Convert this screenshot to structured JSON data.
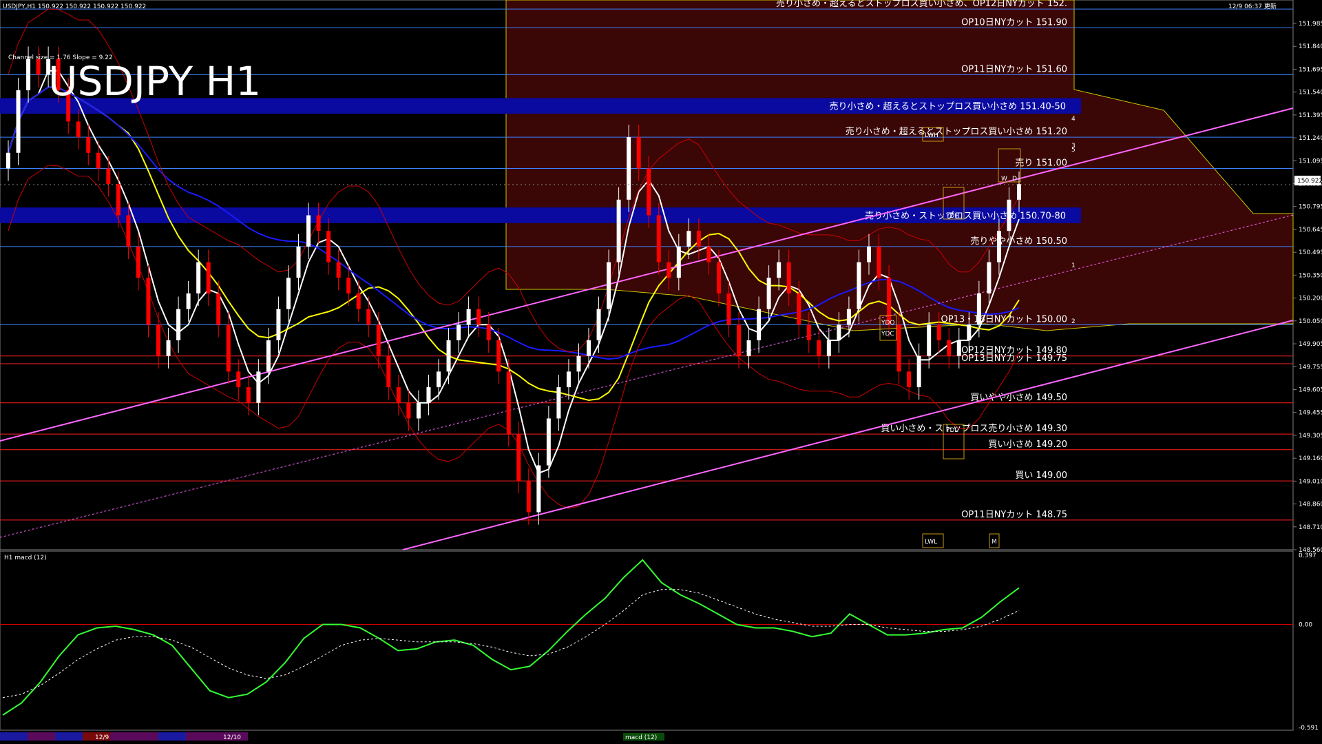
{
  "header": {
    "symbol_line": "USDJPY,H1  150.922 150.922 150.922 150.922",
    "updated": "12/9 06:37 更新",
    "watermark": "USDJPY H1",
    "channel_info": "Channel size = 1.76 Slope = 9.22"
  },
  "colors": {
    "background": "#000000",
    "bull_candle": "#ffffff",
    "bear_candle": "#ff0000",
    "ma_fast": "#ffffff",
    "ma_mid": "#ffff00",
    "ma_slow": "#1a1aff",
    "bollinger": "#cc0000",
    "rci": "#00cc00",
    "channel": "#ff66ff",
    "cloud": "#cc2222",
    "band_zone": "#0a0aa0"
  },
  "price_axis": {
    "ticks": [
      "151.985",
      "151.840",
      "151.695",
      "151.540",
      "151.395",
      "151.240",
      "151.095",
      "150.950",
      "150.795",
      "150.645",
      "150.495",
      "150.350",
      "150.200",
      "150.050",
      "149.905",
      "149.755",
      "149.605",
      "149.455",
      "149.305",
      "149.160",
      "149.010",
      "148.860",
      "148.710",
      "148.560"
    ],
    "current_price": "150.922"
  },
  "macd_axis": {
    "label": "H1 macd (12)",
    "ticks": [
      "0.397",
      "0.00",
      "-0.591"
    ]
  },
  "time_tabs": [
    "12/9",
    "12/10"
  ],
  "bottom_tag": "macd (12)",
  "zones": [
    {
      "name": "zone-151-40",
      "label": "売り小さめ・超えるとストップロス買い小さめ 151.40-50",
      "price": 151.4
    },
    {
      "name": "zone-150-70",
      "label": "売り小さめ・ストップロス買い小さめ 150.70-80",
      "price": 150.7
    }
  ],
  "levels": [
    {
      "name": "level-152",
      "label": "売り小さめ・超えるとストップロス買い小さめ、OP12日NYカット 152.",
      "price": 152.02,
      "color": "#3c82ff"
    },
    {
      "name": "level-151-90",
      "label": "OP10日NYカット 151.90",
      "price": 151.9,
      "color": "#3c82ff"
    },
    {
      "name": "level-151-60",
      "label": "OP11日NYカット 151.60",
      "price": 151.6,
      "color": "#3c82ff"
    },
    {
      "name": "level-151-20",
      "label": "売り小さめ・超えるとストップロス買い小さめ 151.20",
      "price": 151.2,
      "color": "#3c82ff"
    },
    {
      "name": "level-151-00",
      "label": "売り 151.00",
      "price": 151.0,
      "color": "#3c82ff"
    },
    {
      "name": "level-150-50",
      "label": "売りやや小さめ 150.50",
      "price": 150.5,
      "color": "#3c82ff"
    },
    {
      "name": "level-150-00",
      "label": "OP13・16日NYカット 150.00",
      "price": 150.0,
      "color": "#3c82ff"
    },
    {
      "name": "level-149-80",
      "label": "OP12日NYカット 149.80",
      "price": 149.8,
      "color": "#ff2020"
    },
    {
      "name": "level-149-75",
      "label": "OP13日NYカット 149.75",
      "price": 149.75,
      "color": "#ff2020"
    },
    {
      "name": "level-149-50",
      "label": "買いやや小さめ 149.50",
      "price": 149.5,
      "color": "#ff2020"
    },
    {
      "name": "level-149-30",
      "label": "買い小さめ・ストップロス売り小さめ 149.30",
      "price": 149.3,
      "color": "#ff2020"
    },
    {
      "name": "level-149-20",
      "label": "買い小さめ 149.20",
      "price": 149.2,
      "color": "#ff2020"
    },
    {
      "name": "level-149-00",
      "label": "買い 149.00",
      "price": 149.0,
      "color": "#ff2020"
    },
    {
      "name": "level-148-75",
      "label": "OP11日NYカット 148.75",
      "price": 148.75,
      "color": "#ff2020"
    }
  ],
  "box_tags": [
    "YDO",
    "YDC",
    "YDH",
    "YDL",
    "LWH",
    "LWL",
    "W",
    "D",
    "M"
  ],
  "projection_marks": [
    "1",
    "2",
    "3",
    "4",
    "5"
  ],
  "chart_data": {
    "type": "line",
    "title": "USDJPY H1",
    "ylim": [
      148.56,
      152.06
    ],
    "close": [
      151.1,
      151.5,
      151.7,
      151.6,
      151.7,
      151.5,
      151.3,
      151.2,
      151.1,
      151.0,
      150.9,
      150.7,
      150.5,
      150.3,
      150.0,
      149.8,
      149.9,
      150.1,
      150.2,
      150.4,
      150.2,
      150.0,
      149.7,
      149.6,
      149.5,
      149.7,
      149.9,
      150.1,
      150.3,
      150.5,
      150.7,
      150.6,
      150.4,
      150.3,
      150.2,
      150.1,
      150.0,
      149.8,
      149.6,
      149.5,
      149.4,
      149.5,
      149.6,
      149.7,
      149.9,
      150.0,
      150.1,
      150.0,
      149.9,
      149.7,
      149.3,
      149.0,
      148.8,
      149.1,
      149.4,
      149.6,
      149.7,
      149.8,
      149.9,
      150.1,
      150.4,
      150.8,
      151.2,
      151.0,
      150.7,
      150.4,
      150.3,
      150.5,
      150.6,
      150.5,
      150.4,
      150.2,
      150.0,
      149.8,
      149.9,
      150.1,
      150.3,
      150.4,
      150.2,
      150.0,
      149.9,
      149.8,
      149.9,
      150.0,
      150.1,
      150.4,
      150.5,
      150.3,
      150.0,
      149.7,
      149.6,
      149.8,
      150.0,
      149.9,
      149.8,
      149.9,
      150.0,
      150.2,
      150.4,
      150.6,
      150.8,
      150.9
    ],
    "macd": [
      -0.52,
      -0.45,
      -0.33,
      -0.18,
      -0.06,
      -0.02,
      -0.01,
      -0.03,
      -0.06,
      -0.12,
      -0.25,
      -0.38,
      -0.42,
      -0.4,
      -0.33,
      -0.22,
      -0.08,
      0.0,
      0.0,
      -0.02,
      -0.08,
      -0.15,
      -0.14,
      -0.1,
      -0.09,
      -0.12,
      -0.2,
      -0.26,
      -0.24,
      -0.15,
      -0.04,
      0.06,
      0.15,
      0.27,
      0.37,
      0.24,
      0.17,
      0.12,
      0.06,
      0.0,
      -0.02,
      -0.02,
      -0.04,
      -0.07,
      -0.05,
      0.06,
      0.0,
      -0.06,
      -0.06,
      -0.05,
      -0.03,
      -0.02,
      0.04,
      0.13,
      0.21
    ],
    "macd_signal": [
      -0.42,
      -0.4,
      -0.35,
      -0.28,
      -0.2,
      -0.14,
      -0.09,
      -0.07,
      -0.07,
      -0.09,
      -0.13,
      -0.19,
      -0.25,
      -0.29,
      -0.31,
      -0.29,
      -0.24,
      -0.18,
      -0.12,
      -0.09,
      -0.08,
      -0.09,
      -0.1,
      -0.1,
      -0.1,
      -0.11,
      -0.13,
      -0.16,
      -0.18,
      -0.17,
      -0.13,
      -0.07,
      0.0,
      0.08,
      0.17,
      0.2,
      0.2,
      0.18,
      0.14,
      0.1,
      0.06,
      0.03,
      0.01,
      -0.01,
      -0.01,
      0.0,
      0.0,
      -0.02,
      -0.03,
      -0.04,
      -0.04,
      -0.03,
      -0.01,
      0.03,
      0.08
    ]
  }
}
